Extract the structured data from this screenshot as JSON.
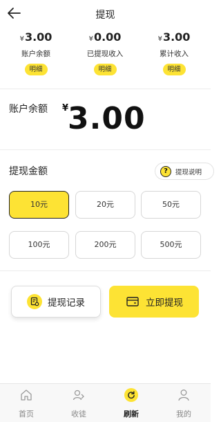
{
  "header": {
    "title": "提现",
    "back_icon": "arrow-left-icon"
  },
  "stats": [
    {
      "currency": "¥",
      "amount": "3.00",
      "label": "账户余额",
      "detail": "明细"
    },
    {
      "currency": "¥",
      "amount": "0.00",
      "label": "已提现收入",
      "detail": "明细"
    },
    {
      "currency": "¥",
      "amount": "3.00",
      "label": "累计收入",
      "detail": "明细"
    }
  ],
  "balance": {
    "label": "账户余额",
    "currency": "¥",
    "amount": "3.00"
  },
  "withdraw": {
    "label": "提现金额",
    "explain": {
      "label": "提现说明",
      "icon": "question-icon",
      "glyph": "?"
    },
    "options": [
      {
        "label": "10元",
        "selected": true
      },
      {
        "label": "20元",
        "selected": false
      },
      {
        "label": "50元",
        "selected": false
      },
      {
        "label": "100元",
        "selected": false
      },
      {
        "label": "200元",
        "selected": false
      },
      {
        "label": "500元",
        "selected": false
      }
    ]
  },
  "actions": {
    "record": {
      "label": "提现记录",
      "icon": "record-icon"
    },
    "withdraw_now": {
      "label": "立即提现",
      "icon": "wallet-icon"
    }
  },
  "tabbar": [
    {
      "label": "首页",
      "icon": "home-icon",
      "active": false
    },
    {
      "label": "收徒",
      "icon": "invite-icon",
      "active": false
    },
    {
      "label": "刷新",
      "icon": "refresh-icon",
      "active": true
    },
    {
      "label": "我的",
      "icon": "user-icon",
      "active": false
    }
  ],
  "colors": {
    "accent": "#FDE334",
    "text": "#222222",
    "muted": "#888888"
  }
}
